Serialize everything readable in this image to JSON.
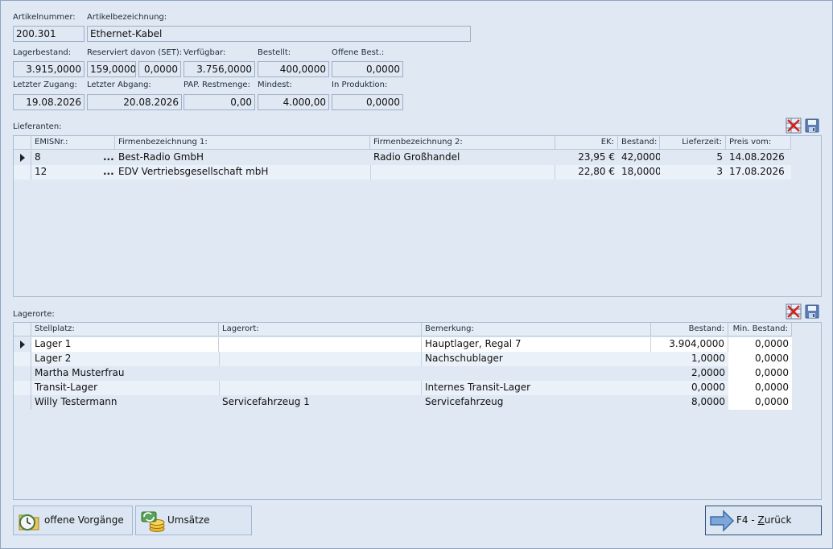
{
  "header": {
    "artikelnummer_label": "Artikelnummer:",
    "artikelnummer": "200.301",
    "bezeichnung_label": "Artikelbezeichnung:",
    "bezeichnung": "Ethernet-Kabel"
  },
  "stock": {
    "lagerbestand_label": "Lagerbestand:",
    "lagerbestand": "3.915,0000",
    "reserviert_label": "Reserviert davon (SET):",
    "reserviert": "159,0000",
    "reserviert_set": "0,0000",
    "verfuegbar_label": "Verfügbar:",
    "verfuegbar": "3.756,0000",
    "bestellt_label": "Bestellt:",
    "bestellt": "400,0000",
    "offene_label": "Offene Best.:",
    "offene": "0,0000",
    "zugang_label": "Letzter Zugang:",
    "zugang": "19.08.2026",
    "abgang_label": "Letzter Abgang:",
    "abgang": "20.08.2026",
    "pap_label": "PAP. Restmenge:",
    "pap": "0,00",
    "mindest_label": "Mindest:",
    "mindest": "4.000,00",
    "produktion_label": "In Produktion:",
    "produktion": "0,0000"
  },
  "lieferanten": {
    "title": "Lieferanten:",
    "columns": [
      "EMISNr.:",
      "Firmenbezeichnung 1:",
      "Firmenbezeichnung 2:",
      "EK:",
      "Bestand:",
      "Lieferzeit:",
      "Preis vom:"
    ],
    "rows": [
      {
        "nr": "8",
        "dots": "...",
        "firma1": "Best-Radio GmbH",
        "firma2": "Radio Großhandel",
        "ek": "23,95 €",
        "bestand": "42,0000",
        "lieferzeit": "5",
        "preis_vom": "14.08.2026"
      },
      {
        "nr": "12",
        "dots": "...",
        "firma1": "EDV Vertriebsgesellschaft mbH",
        "firma2": "",
        "ek": "22,80 €",
        "bestand": "18,0000",
        "lieferzeit": "3",
        "preis_vom": "17.08.2026"
      }
    ]
  },
  "lagerorte": {
    "title": "Lagerorte:",
    "columns": [
      "Stellplatz:",
      "Lagerort:",
      "Bemerkung:",
      "Bestand:",
      "Min. Bestand:"
    ],
    "rows": [
      {
        "stellplatz": "Lager 1",
        "lagerort": "",
        "bemerkung": "Hauptlager, Regal 7",
        "bestand": "3.904,0000",
        "min": "0,0000"
      },
      {
        "stellplatz": "Lager 2",
        "lagerort": "",
        "bemerkung": "Nachschublager",
        "bestand": "1,0000",
        "min": "0,0000"
      },
      {
        "stellplatz": "Martha Musterfrau",
        "lagerort": "",
        "bemerkung": "",
        "bestand": "2,0000",
        "min": "0,0000"
      },
      {
        "stellplatz": "Transit-Lager",
        "lagerort": "",
        "bemerkung": "Internes Transit-Lager",
        "bestand": "0,0000",
        "min": "0,0000"
      },
      {
        "stellplatz": "Willy Testermann",
        "lagerort": "Servicefahrzeug 1",
        "bemerkung": "Servicefahrzeug",
        "bestand": "8,0000",
        "min": "0,0000"
      }
    ]
  },
  "buttons": {
    "vorgaenge": "offene Vorgänge",
    "umsaetze": "Umsätze",
    "zurueck_prefix": "F4 - ",
    "zurueck_underlined": "Z",
    "zurueck_rest": "urück"
  },
  "icons": {
    "delete": "delete-grid-icon",
    "save": "save-disk-icon",
    "vorgaenge": "clock-folder-icon",
    "umsaetze": "coins-refresh-icon",
    "zurueck": "arrow-right-icon"
  }
}
